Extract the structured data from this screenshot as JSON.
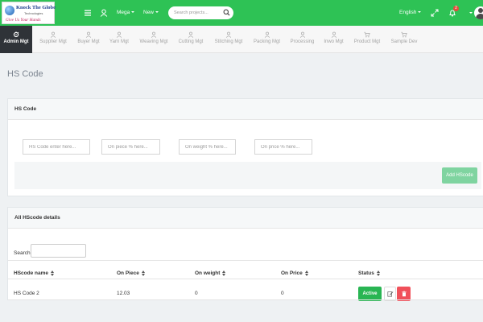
{
  "brand": {
    "name": "Knock The Globe",
    "sub": "Technologies",
    "tagline": "Give Us Your Hands"
  },
  "topbar": {
    "menu_icon": "hamburger-icon",
    "user_icon": "user-icon",
    "mega_label": "Mega",
    "new_label": "New",
    "search_placeholder": "Search projects...",
    "language": "English",
    "notification_count": "2",
    "colors": {
      "bar": "#2ec255"
    }
  },
  "modules": [
    {
      "label": "Admin Mgt",
      "icon": "gear-icon",
      "active": true
    },
    {
      "label": "Supplier Mgt",
      "icon": "user-icon"
    },
    {
      "label": "Buyer Mgt",
      "icon": "user-icon"
    },
    {
      "label": "Yarn Mgt",
      "icon": "user-icon"
    },
    {
      "label": "Weaving Mgt",
      "icon": "user-icon"
    },
    {
      "label": "Cutting Mgt",
      "icon": "user-icon"
    },
    {
      "label": "Stitching Mgt",
      "icon": "user-icon"
    },
    {
      "label": "Packing Mgt",
      "icon": "user-icon"
    },
    {
      "label": "Processing",
      "icon": "user-icon"
    },
    {
      "label": "Inwo Mgt",
      "icon": "user-icon"
    },
    {
      "label": "Product Mgt",
      "icon": "cart-icon"
    },
    {
      "label": "Sample Dev",
      "icon": "cart-icon"
    }
  ],
  "page": {
    "title": "HS Code"
  },
  "form": {
    "title": "HS Code",
    "hs_code_placeholder": "HS Code enter here...",
    "on_piece_placeholder": "On piece % here...",
    "on_weight_placeholder": "On weight % here...",
    "on_price_placeholder": "On price % here...",
    "add_button": "Add HScode"
  },
  "table": {
    "title": "All HScode details",
    "search_label": "Search:",
    "columns": [
      "HScode name",
      "On Piece",
      "On weight",
      "On Price",
      "Status"
    ],
    "rows": [
      {
        "name": "HS Code 2",
        "on_piece": "12.03",
        "on_weight": "0",
        "on_price": "0",
        "status": "Active"
      }
    ]
  }
}
